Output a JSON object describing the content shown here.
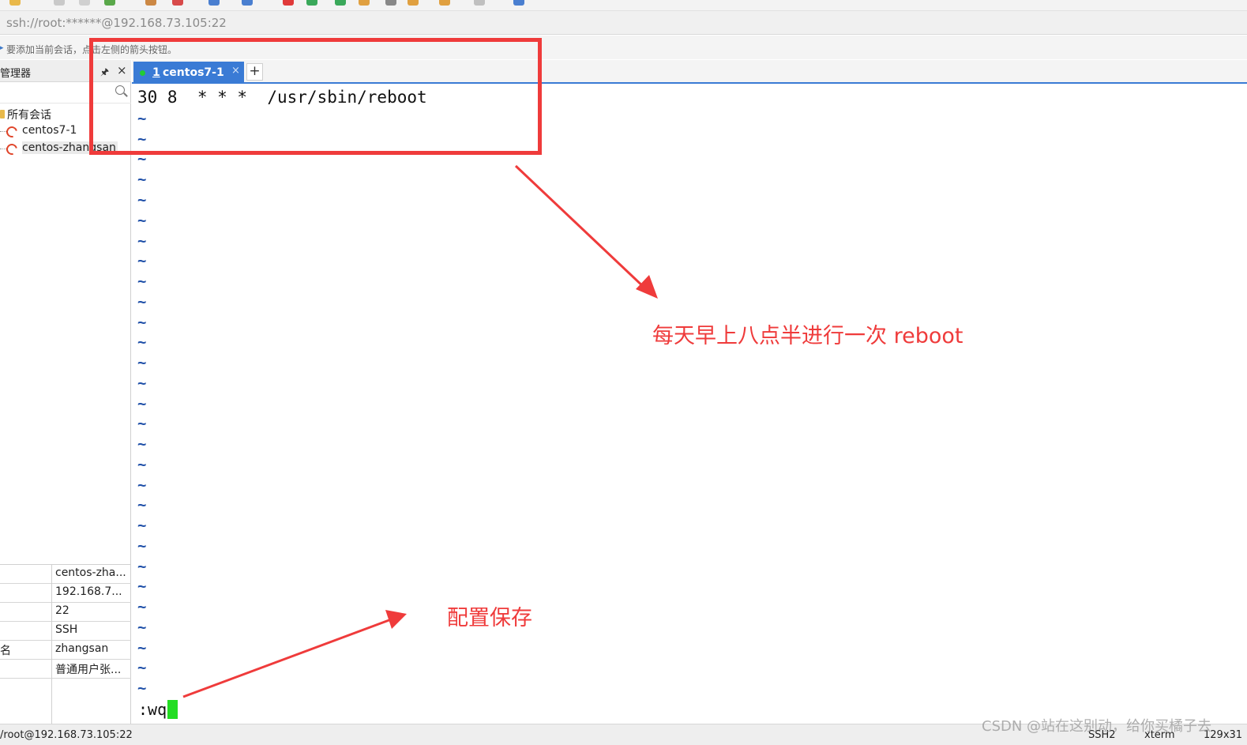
{
  "address_bar": {
    "url": "ssh://root:******@192.168.73.105:22"
  },
  "hint_bar": {
    "text": "要添加当前会话，点击左侧的箭头按钮。"
  },
  "session_panel": {
    "title": "管理器",
    "pin_icon": "pin-icon",
    "close_icon": "close-icon",
    "search_icon": "search-icon",
    "tree": {
      "root_label": "所有会话",
      "items": [
        {
          "label": "centos7-1",
          "icon": "session-icon"
        },
        {
          "label": "centos-zhangsan",
          "icon": "session-icon"
        }
      ]
    },
    "properties": [
      {
        "key": "",
        "value": "centos-zha..."
      },
      {
        "key": "",
        "value": "192.168.7..."
      },
      {
        "key": "",
        "value": "22"
      },
      {
        "key": "",
        "value": "SSH"
      },
      {
        "key": "名",
        "value": "zhangsan"
      },
      {
        "key": "",
        "value": "普通用户张..."
      }
    ]
  },
  "tabs": {
    "active": {
      "number": "1",
      "label": "centos7-1",
      "status_color": "#22cc33"
    },
    "add_label": "+"
  },
  "terminal": {
    "line1": "30 8  * * *  /usr/sbin/reboot",
    "tilde": "~",
    "command": ":wq"
  },
  "annotations": {
    "reboot_note": "每天早上八点半进行一次  reboot",
    "save_note": "配置保存",
    "color": "#ef3b3b"
  },
  "status_bar": {
    "host": "/root@192.168.73.105:22",
    "protocol": "SSH2",
    "terminal_type": "xterm",
    "size": "129x31"
  },
  "watermark": "CSDN @站在这别动，给你买橘子去",
  "colors": {
    "accent": "#3a7bd5",
    "tilde": "#1e4fa8",
    "cursor": "#22dd22"
  }
}
